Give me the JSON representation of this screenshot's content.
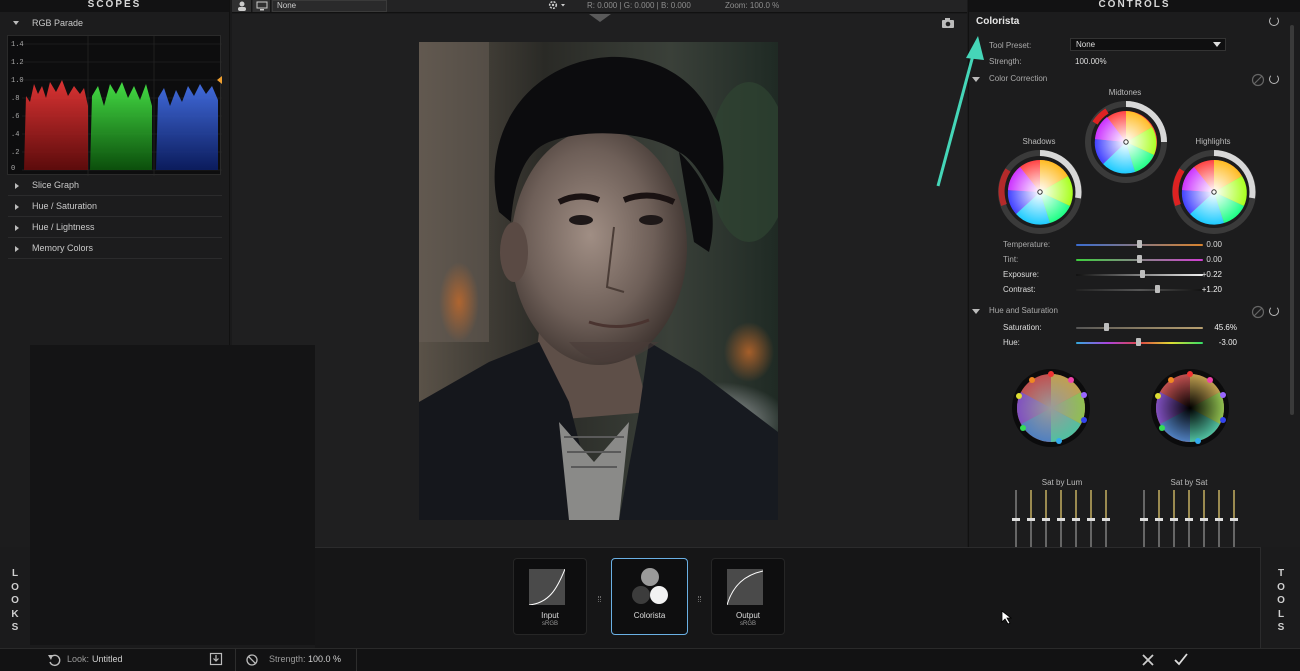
{
  "scopes": {
    "title": "SCOPES",
    "rgb_parade_label": "RGB Parade",
    "y_ticks": [
      "1.4",
      "1.2",
      "1.0",
      ".8",
      ".6",
      ".4",
      ".2",
      "0"
    ],
    "sections": [
      "Slice Graph",
      "Hue / Saturation",
      "Hue / Lightness",
      "Memory Colors"
    ]
  },
  "toolbar": {
    "preset_value": "None",
    "rgb_readout": "R: 0.000 | G: 0.000 | B: 0.000",
    "zoom_readout": "Zoom: 100.0 %"
  },
  "controls": {
    "title": "CONTROLS",
    "tool_name": "Colorista",
    "tool_preset_label": "Tool Preset:",
    "tool_preset_value": "None",
    "strength_label": "Strength:",
    "strength_value": "100.00%",
    "color_correction_label": "Color Correction",
    "wheels": {
      "midtones": "Midtones",
      "shadows": "Shadows",
      "highlights": "Highlights"
    },
    "sliders": [
      {
        "label": "Temperature:",
        "value": "0.00"
      },
      {
        "label": "Tint:",
        "value": "0.00"
      },
      {
        "label": "Exposure:",
        "value": "+0.22"
      },
      {
        "label": "Contrast:",
        "value": "+1.20"
      }
    ],
    "hue_sat_label": "Hue and Saturation",
    "hs_sliders": [
      {
        "label": "Saturation:",
        "value": "45.6%"
      },
      {
        "label": "Hue:",
        "value": "-3.00"
      }
    ],
    "sat_by_lum": "Sat by Lum",
    "sat_by_sat": "Sat by Sat"
  },
  "bottom": {
    "left_tab": "LOOKS",
    "right_tab": "TOOLS",
    "nodes": [
      {
        "title": "Input",
        "sub": "sRGB"
      },
      {
        "title": "Colorista",
        "sub": ""
      },
      {
        "title": "Output",
        "sub": "sRGB"
      }
    ]
  },
  "status": {
    "look_label": "Look:",
    "look_value": "Untitled",
    "strength_label": "Strength:",
    "strength_value": "100.0 %"
  },
  "colors": {
    "accent_teal": "#45d6b8",
    "selected_node": "#6ab0e4"
  }
}
